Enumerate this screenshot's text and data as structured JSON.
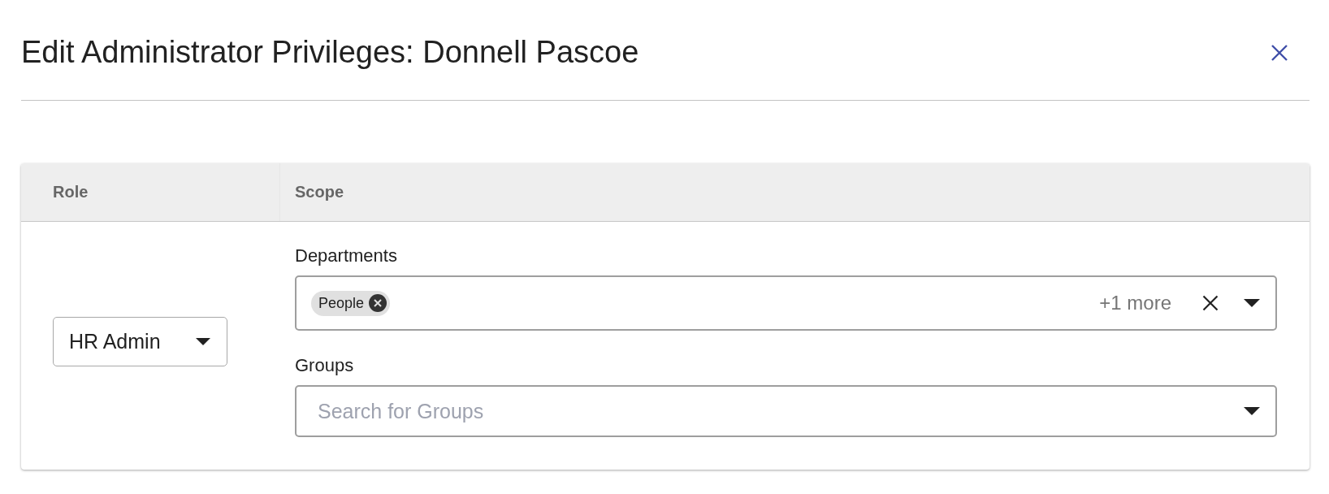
{
  "dialog": {
    "title": "Edit Administrator Privileges: Donnell Pascoe"
  },
  "table": {
    "columns": [
      "Role",
      "Scope"
    ],
    "rows": [
      {
        "role": "HR Admin",
        "scope": {
          "fields": [
            {
              "kind": "multiselect",
              "label": "Departments",
              "chips": [
                "People"
              ],
              "more": "+1 more"
            },
            {
              "kind": "search",
              "label": "Groups",
              "placeholder": "Search for Groups"
            }
          ]
        }
      }
    ]
  }
}
